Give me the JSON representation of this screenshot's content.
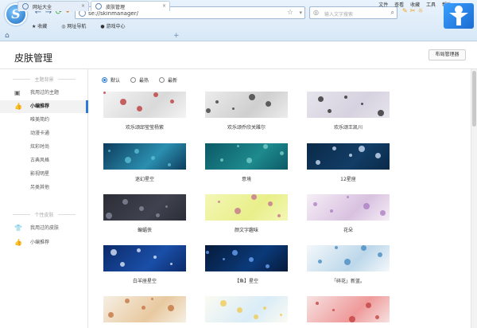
{
  "browser": {
    "logo_letter": "S",
    "url": "se://skinmanager/",
    "search_placeholder": "输入文字搜索",
    "menu": [
      "文件",
      "查看",
      "收藏",
      "工具",
      "帮助"
    ],
    "favorites": [
      "收藏",
      "网址导航",
      "游戏中心"
    ],
    "tabs": [
      {
        "label": "网址大全",
        "active": false
      },
      {
        "label": "皮肤管理",
        "active": true
      }
    ]
  },
  "page": {
    "title": "皮肤管理",
    "layout_button": "布局管理器"
  },
  "sidebar": {
    "section1": "主题背景",
    "items1": [
      {
        "label": "我用过的主题",
        "icon": "image-icon",
        "active": false
      },
      {
        "label": "小编推荐",
        "icon": "thumbs-up-icon",
        "active": true
      },
      {
        "label": "唯美简约",
        "active": false
      },
      {
        "label": "动漫卡通",
        "active": false
      },
      {
        "label": "炫彩时尚",
        "active": false
      },
      {
        "label": "古典风格",
        "active": false
      },
      {
        "label": "影视明星",
        "active": false
      },
      {
        "label": "另类其他",
        "active": false
      }
    ],
    "section2": "个性皮肤",
    "items2": [
      {
        "label": "我用过的皮肤",
        "icon": "shirt-icon"
      },
      {
        "label": "小编推荐",
        "icon": "thumbs-up-icon"
      }
    ]
  },
  "sort": {
    "options": [
      "默认",
      "最热",
      "最新"
    ],
    "selected": "默认"
  },
  "skins": [
    {
      "name": "欢乐颂邱莹莹杨紫",
      "colors": [
        "#f4f4f4",
        "#d9d9d9",
        "#b33"
      ]
    },
    {
      "name": "欢乐颂乔欣关雎尔",
      "colors": [
        "#ececec",
        "#cfcfcf",
        "#333"
      ]
    },
    {
      "name": "欢乐颂王凯川",
      "colors": [
        "#e6e4ec",
        "#d6d2e0",
        "#222"
      ]
    },
    {
      "name": "迷幻星空",
      "colors": [
        "#0d3c5c",
        "#2b8fb0",
        "#5fc3d8"
      ]
    },
    {
      "name": "意境",
      "colors": [
        "#0c5a66",
        "#1e8a8e",
        "#7fd3d0"
      ]
    },
    {
      "name": "12星座",
      "colors": [
        "#0a2a48",
        "#123d66",
        "#d8e8ff"
      ]
    },
    {
      "name": "蝙蝠侠",
      "colors": [
        "#2b2d36",
        "#40434f",
        "#8a8fa0"
      ]
    },
    {
      "name": "颜文字趣味",
      "colors": [
        "#f4f7b5",
        "#e8ef8a",
        "#c26d8e"
      ]
    },
    {
      "name": "花朵",
      "colors": [
        "#f6eef6",
        "#d8c1e0",
        "#a77ac2"
      ]
    },
    {
      "name": "白羊座星空",
      "colors": [
        "#0c2a6a",
        "#1a4fa8",
        "#e8f2ff"
      ]
    },
    {
      "name": "【鱼】星空",
      "colors": [
        "#061a3a",
        "#0b3a7a",
        "#6fa9ff"
      ]
    },
    {
      "name": "「碎花」新蓝。",
      "colors": [
        "#f4f8fb",
        "#bcd7ea",
        "#3f86bf"
      ]
    },
    {
      "name": "",
      "colors": [
        "#f6efe4",
        "#e8c9a0",
        "#c2703a"
      ]
    },
    {
      "name": "",
      "colors": [
        "#fbfbf2",
        "#d9ecf7",
        "#f0c84a"
      ]
    },
    {
      "name": "",
      "colors": [
        "#f7e2e2",
        "#ef9a9a",
        "#c23b3b"
      ]
    }
  ]
}
